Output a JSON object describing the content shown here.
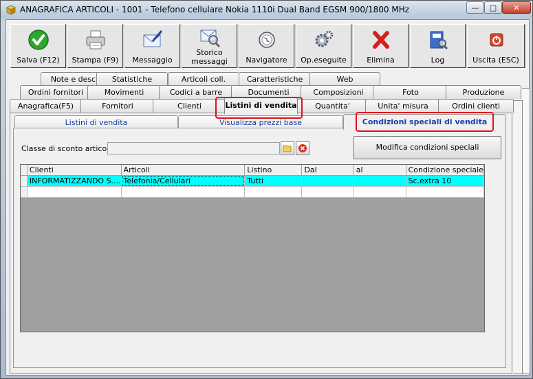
{
  "window": {
    "title": "ANAGRAFICA ARTICOLI - 1001 - Telefono cellulare Nokia 1110i Dual Band EGSM 900/1800 MHz",
    "minimize_icon": "minimize-icon",
    "maximize_icon": "maximize-icon",
    "close_icon": "close-icon"
  },
  "toolbar": {
    "buttons": [
      {
        "label": "Salva (F12)",
        "icon": "check-icon"
      },
      {
        "label": "Stampa (F9)",
        "icon": "printer-icon"
      },
      {
        "label": "Messaggio",
        "icon": "envelope-pen-icon"
      },
      {
        "label": "Storico messaggi",
        "line1": "Storico",
        "line2": "messaggi",
        "icon": "envelope-search-icon"
      },
      {
        "label": "Navigatore",
        "icon": "compass-icon"
      },
      {
        "label": "Op.eseguite",
        "icon": "gears-icon"
      },
      {
        "label": "Elimina",
        "icon": "delete-x-icon"
      },
      {
        "label": "Log",
        "icon": "log-book-icon"
      },
      {
        "label": "Uscita (ESC)",
        "icon": "power-icon"
      }
    ]
  },
  "tabs": {
    "row1": [
      "Note e descr.",
      "Statistiche",
      "Articoli coll.",
      "Caratteristiche",
      "Web"
    ],
    "row2": [
      "Ordini fornitori",
      "Movimenti",
      "Codici a barre",
      "Documenti",
      "Composizioni",
      "Foto",
      "Produzione"
    ],
    "row3": [
      "Anagrafica(F5)",
      "Fornitori",
      "Clienti",
      "Listini di vendita",
      "Quantita'",
      "Unita' misura",
      "Ordini clienti"
    ],
    "active": "Listini di vendita"
  },
  "subtabs": {
    "items": [
      "Listini di vendita",
      "Visualizza prezzi base",
      "Condizioni speciali di vendita"
    ],
    "active": "Condizioni speciali di vendita"
  },
  "form": {
    "discount_class_label": "Classe di sconto articolo :",
    "discount_class_value": "",
    "modify_button": "Modifica condizioni speciali"
  },
  "grid": {
    "columns": [
      "Clienti",
      "Articoli",
      "Listino",
      "Dal",
      "al",
      "Condizione speciale"
    ],
    "rows": [
      [
        "INFORMATIZZANDO S....",
        "Telefonia/Cellulari",
        "Tutti",
        "",
        "",
        "Sc.extra 10"
      ]
    ]
  }
}
